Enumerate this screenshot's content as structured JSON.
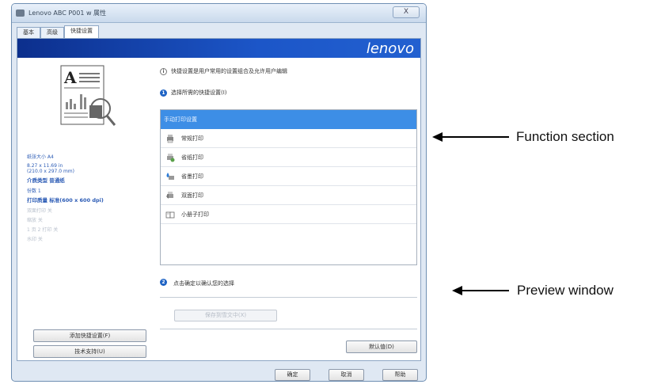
{
  "window": {
    "title": "Lenovo ABC P001 w 属性",
    "close_label": "X"
  },
  "tabs": [
    {
      "label": "基本"
    },
    {
      "label": "高级"
    },
    {
      "label": "快捷设置"
    }
  ],
  "brand": "lenovo",
  "left_panel": {
    "info": [
      {
        "text": "纸张大小 A4",
        "style": "blue"
      },
      {
        "text": "8.27 x 11.69 in",
        "style": "blue"
      },
      {
        "text": "(210.0 x 297.0 mm)",
        "style": "blue"
      },
      {
        "text": "介质类型 普通纸",
        "style": "blue-bold"
      },
      {
        "text": "份数 1",
        "style": "blue"
      },
      {
        "text": "打印质量 标准(600 x 600 dpi)",
        "style": "blue-bold"
      },
      {
        "text": "双面打印 关",
        "style": "grey"
      },
      {
        "text": "缩放 关",
        "style": "grey"
      },
      {
        "text": "1 页 2 打印 关",
        "style": "grey"
      },
      {
        "text": "水印 关",
        "style": "grey"
      }
    ],
    "buttons": {
      "add_shortcut": "添加快捷设置(F)",
      "support": "技术支持(U)"
    }
  },
  "right_panel": {
    "info_note": "快捷设置是用户常用的设置组合及允许用户编辑",
    "step1": "选择所需的快捷设置(I)",
    "step2": "点击确定以确认您的选择",
    "list": [
      {
        "label": "手动打印设置",
        "icon": "selected-icon",
        "selected": true
      },
      {
        "label": "常规打印",
        "icon": "printer-icon",
        "selected": false
      },
      {
        "label": "省纸打印",
        "icon": "eco-printer-icon",
        "selected": false
      },
      {
        "label": "省墨打印",
        "icon": "ink-drop-icon",
        "selected": false
      },
      {
        "label": "双面打印",
        "icon": "duplex-icon",
        "selected": false
      },
      {
        "label": "小册子打印",
        "icon": "booklet-icon",
        "selected": false
      }
    ],
    "save_button": "保存到雪文中(X)",
    "default_button": "默认值(D)"
  },
  "footer": {
    "ok": "确定",
    "cancel": "取消",
    "help": "帮助"
  },
  "annotations": {
    "function_section": "Function section",
    "preview_window": "Preview window"
  },
  "colors": {
    "brand_bar": "#1c56c8",
    "selection": "#3d8ee6",
    "info_blue": "#2b5bb5"
  }
}
